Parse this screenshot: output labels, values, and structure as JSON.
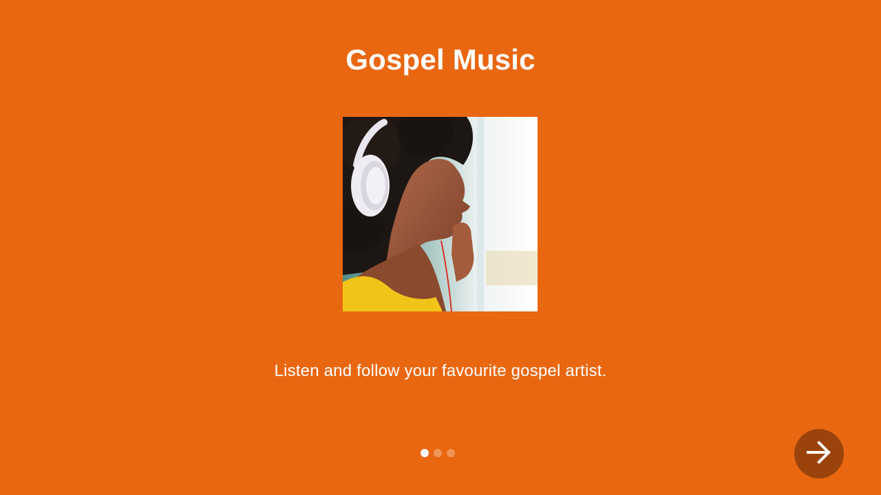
{
  "screen": {
    "title": "Gospel Music",
    "description": "Listen and follow your favourite gospel artist.",
    "background_color": "#e96711"
  },
  "hero_image": {
    "alt": "Woman listening to music with headphones"
  },
  "pager": {
    "total_pages": 3,
    "current_page": 1
  },
  "next_button": {
    "icon": "arrow-right-icon",
    "color": "#9a440c"
  }
}
